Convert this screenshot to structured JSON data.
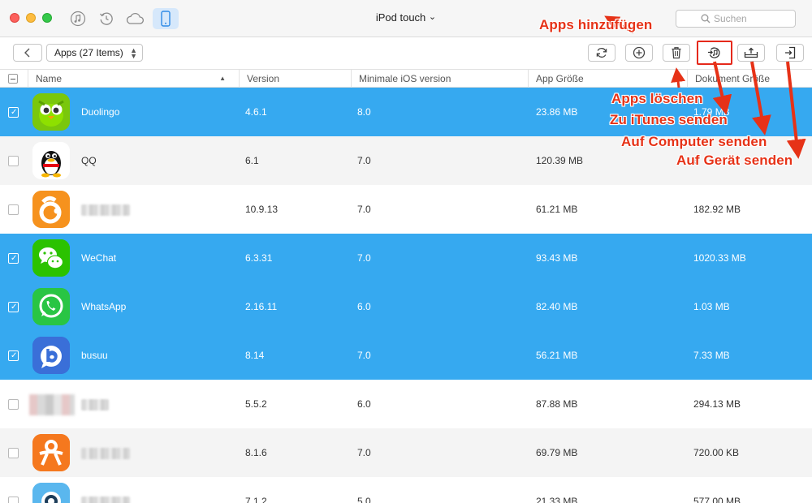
{
  "window": {
    "title": "iPod touch",
    "title_chevron": "⌄"
  },
  "titlebar_icons": [
    "music-icon",
    "history-icon",
    "icloud-icon",
    "device-icon"
  ],
  "search": {
    "placeholder": "Suchen"
  },
  "toolbar": {
    "category_label": "Apps (27 Items)",
    "buttons": [
      "refresh-icon",
      "add-icon",
      "delete-icon",
      "to-itunes-icon",
      "to-computer-icon",
      "to-device-icon"
    ]
  },
  "table": {
    "columns": [
      "Name",
      "Version",
      "Minimale iOS version",
      "App Größe",
      "Dokument Größe"
    ],
    "rows": [
      {
        "name": "Duolingo",
        "version": "4.6.1",
        "min_ios": "8.0",
        "app_size": "23.86 MB",
        "doc_size": "1.79 MB",
        "selected": true
      },
      {
        "name": "QQ",
        "version": "6.1",
        "min_ios": "7.0",
        "app_size": "120.39 MB",
        "doc_size": "6",
        "selected": false
      },
      {
        "name": "",
        "version": "10.9.13",
        "min_ios": "7.0",
        "app_size": "61.21 MB",
        "doc_size": "182.92 MB",
        "selected": false
      },
      {
        "name": "WeChat",
        "version": "6.3.31",
        "min_ios": "7.0",
        "app_size": "93.43 MB",
        "doc_size": "1020.33 MB",
        "selected": true
      },
      {
        "name": "WhatsApp",
        "version": "2.16.11",
        "min_ios": "6.0",
        "app_size": "82.40 MB",
        "doc_size": "1.03 MB",
        "selected": true
      },
      {
        "name": "busuu",
        "version": "8.14",
        "min_ios": "7.0",
        "app_size": "56.21 MB",
        "doc_size": "7.33 MB",
        "selected": true
      },
      {
        "name": "",
        "version": "5.5.2",
        "min_ios": "6.0",
        "app_size": "87.88 MB",
        "doc_size": "294.13 MB",
        "selected": false
      },
      {
        "name": "",
        "version": "8.1.6",
        "min_ios": "7.0",
        "app_size": "69.79 MB",
        "doc_size": "720.00 KB",
        "selected": false
      },
      {
        "name": "",
        "version": "7.1.2",
        "min_ios": "5.0",
        "app_size": "21.33 MB",
        "doc_size": "577.00 MB",
        "selected": false
      }
    ]
  },
  "annotations": {
    "add": "Apps hinzufügen",
    "delete": "Apps löschen",
    "itunes": "Zu iTunes senden",
    "computer": "Auf Computer senden",
    "device": "Auf Gerät senden"
  },
  "colors": {
    "selection": "#36a9f0",
    "annotation": "#e63217",
    "highlight_border": "#e5291b"
  }
}
